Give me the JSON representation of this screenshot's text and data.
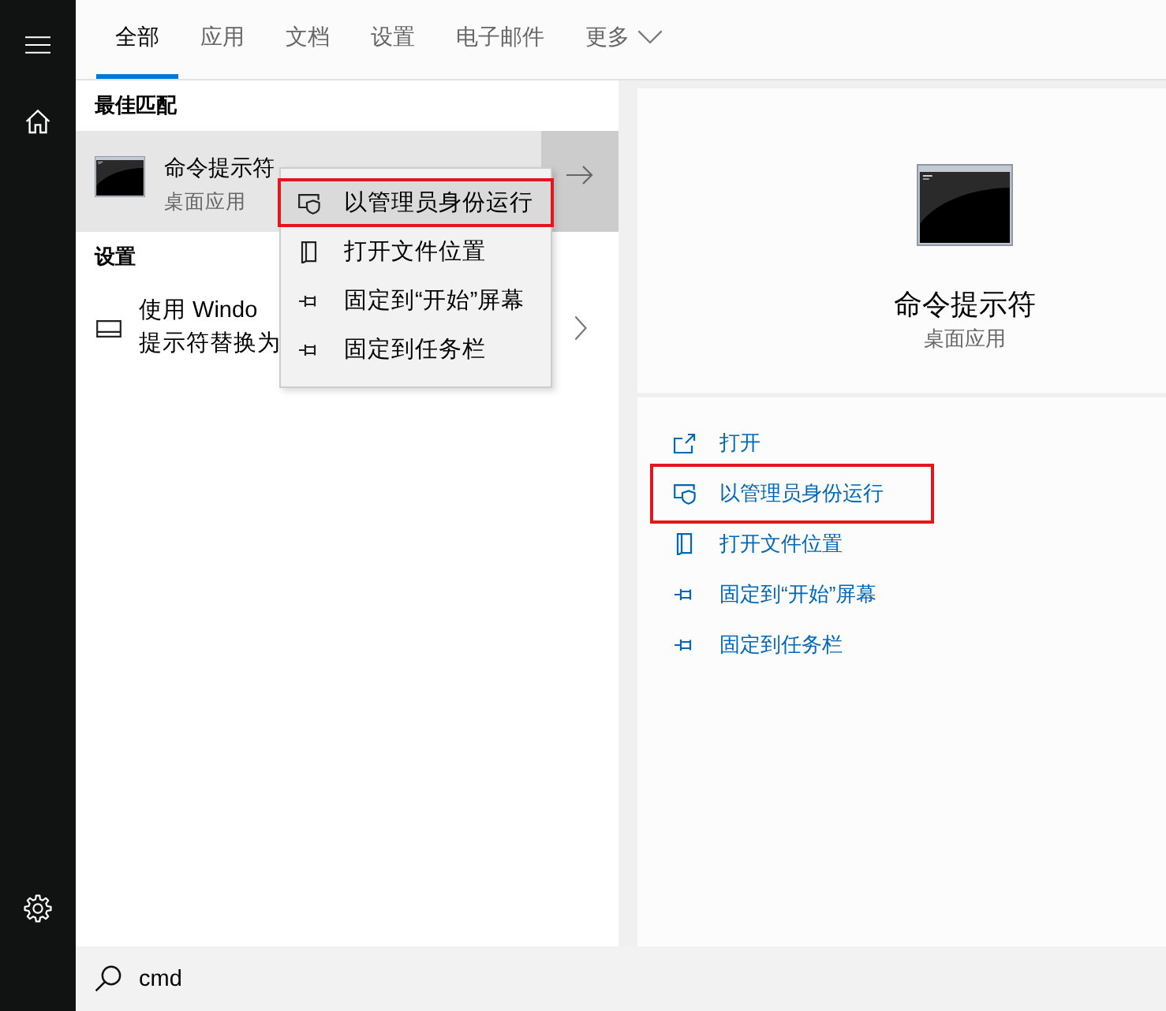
{
  "tabs": [
    {
      "label": "全部",
      "kind": "tab",
      "selected": true
    },
    {
      "label": "应用",
      "kind": "tab",
      "selected": false
    },
    {
      "label": "文档",
      "kind": "tab",
      "selected": false
    },
    {
      "label": "设置",
      "kind": "tab",
      "selected": false
    },
    {
      "label": "电子邮件",
      "kind": "tab",
      "selected": false
    },
    {
      "label": "更多",
      "kind": "dropdown",
      "selected": false
    }
  ],
  "best_match": {
    "heading": "最佳匹配",
    "result": {
      "title": "命令提示符",
      "subtitle": "桌面应用",
      "selected": true
    }
  },
  "settings": {
    "heading": "设置",
    "items": [
      {
        "lines": [
          "使用 Windo",
          "提示符替换为"
        ]
      }
    ]
  },
  "context_menu": {
    "items": [
      {
        "label": "以管理员身份运行",
        "kind": "admin",
        "selected": true,
        "annotated": true
      },
      {
        "label": "打开文件位置",
        "kind": "location",
        "selected": false,
        "annotated": false
      },
      {
        "label": "固定到“开始”屏幕",
        "kind": "pin",
        "selected": false,
        "annotated": false
      },
      {
        "label": "固定到任务栏",
        "kind": "pin",
        "selected": false,
        "annotated": false
      }
    ]
  },
  "preview": {
    "title": "命令提示符",
    "subtitle": "桌面应用",
    "actions": [
      {
        "label": "打开",
        "kind": "open",
        "annotated": false
      },
      {
        "label": "以管理员身份运行",
        "kind": "admin",
        "annotated": true
      },
      {
        "label": "打开文件位置",
        "kind": "location",
        "annotated": false
      },
      {
        "label": "固定到“开始”屏幕",
        "kind": "pin",
        "annotated": false
      },
      {
        "label": "固定到任务栏",
        "kind": "pin",
        "annotated": false
      }
    ]
  },
  "search": {
    "value": "cmd"
  }
}
